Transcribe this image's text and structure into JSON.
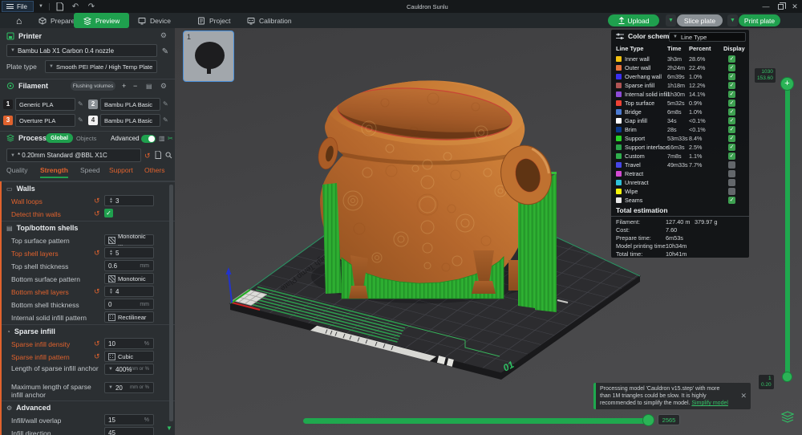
{
  "titlebar": {
    "file": "File",
    "title": "Cauldron Sunlu"
  },
  "toolbar": {
    "tabs": [
      {
        "label": "Prepare",
        "icon": "prepare-icon",
        "active": false
      },
      {
        "label": "Preview",
        "icon": "preview-icon",
        "active": true
      },
      {
        "label": "Device",
        "icon": "device-icon",
        "active": false
      },
      {
        "label": "Project",
        "icon": "project-icon",
        "active": false
      },
      {
        "label": "Calibration",
        "icon": "calibration-icon",
        "active": false
      }
    ],
    "upload": "Upload",
    "slice": "Slice plate",
    "print": "Print plate"
  },
  "printer": {
    "title": "Printer",
    "name": "Bambu Lab X1 Carbon 0.4 nozzle",
    "plate_type_label": "Plate type",
    "plate_type": "Smooth PEI Plate / High Temp Plate"
  },
  "filament": {
    "title": "Filament",
    "flushing": "Flushing volumes",
    "slots": [
      {
        "num": "1",
        "color": "#1d1d1f",
        "text": "#ffffff",
        "name": "Generic PLA"
      },
      {
        "num": "2",
        "color": "#8b9196",
        "text": "#ffffff",
        "name": "Bambu PLA Basic"
      },
      {
        "num": "3",
        "color": "#e0622d",
        "text": "#ffffff",
        "name": "Overture PLA"
      },
      {
        "num": "4",
        "color": "#f2f2f2",
        "text": "#333333",
        "name": "Bambu PLA Basic"
      }
    ]
  },
  "process": {
    "title": "Process",
    "global": "Global",
    "objects": "Objects",
    "advanced": "Advanced",
    "preset": "* 0.20mm Standard @BBL X1C",
    "tabs": [
      {
        "label": "Quality",
        "state": "normal"
      },
      {
        "label": "Strength",
        "state": "selected"
      },
      {
        "label": "Speed",
        "state": "normal"
      },
      {
        "label": "Support",
        "state": "modified"
      },
      {
        "label": "Others",
        "state": "modified"
      }
    ]
  },
  "settings": {
    "sections": [
      {
        "title": "Walls",
        "rows": [
          {
            "label": "Wall loops",
            "mod": true,
            "reset": true,
            "type": "spin",
            "value": "3"
          },
          {
            "label": "Detect thin walls",
            "mod": true,
            "reset": true,
            "type": "check",
            "checked": true
          }
        ]
      },
      {
        "title": "Top/bottom shells",
        "rows": [
          {
            "label": "Top surface pattern",
            "type": "pattern",
            "value": "Monotonic ..."
          },
          {
            "label": "Top shell layers",
            "mod": true,
            "reset": true,
            "type": "spin",
            "value": "5"
          },
          {
            "label": "Top shell thickness",
            "type": "unit",
            "value": "0.6",
            "unit": "mm"
          },
          {
            "label": "Bottom surface pattern",
            "type": "pattern",
            "value": "Monotonic"
          },
          {
            "label": "Bottom shell layers",
            "mod": true,
            "reset": true,
            "type": "spin",
            "value": "4"
          },
          {
            "label": "Bottom shell thickness",
            "type": "unit",
            "value": "0",
            "unit": "mm"
          },
          {
            "label": "Internal solid infill pattern",
            "type": "pattern",
            "value": "Rectilinear",
            "pat": "dots"
          }
        ]
      },
      {
        "title": "Sparse infill",
        "rows": [
          {
            "label": "Sparse infill density",
            "mod": true,
            "reset": true,
            "type": "unit",
            "value": "10",
            "unit": "%"
          },
          {
            "label": "Sparse infill pattern",
            "mod": true,
            "reset": true,
            "type": "pattern",
            "value": "Cubic",
            "pat": "dots"
          },
          {
            "label": "Length of sparse infill anchor",
            "twoline": true,
            "type": "combo",
            "value": "400%",
            "unit": "mm or %"
          },
          {
            "label": "Maximum length of sparse infill anchor",
            "twoline": true,
            "type": "combo",
            "value": "20",
            "unit": "mm or %"
          }
        ]
      },
      {
        "title": "Advanced",
        "rows": [
          {
            "label": "Infill/wall overlap",
            "type": "unit",
            "value": "15",
            "unit": "%"
          },
          {
            "label": "Infill direction",
            "type": "unit",
            "value": "45",
            "unit": ""
          }
        ]
      }
    ]
  },
  "color_scheme": {
    "title": "Color scheme",
    "dropdown": "Line Type",
    "columns": [
      "Line Type",
      "Time",
      "Percent",
      "Display"
    ],
    "rows": [
      {
        "name": "Inner wall",
        "color": "#f5c211",
        "time": "3h3m",
        "pct": "28.6%",
        "on": true
      },
      {
        "name": "Outer wall",
        "color": "#e8733d",
        "time": "2h24m",
        "pct": "22.4%",
        "on": true
      },
      {
        "name": "Overhang wall",
        "color": "#3a2ff0",
        "time": "6m39s",
        "pct": "1.0%",
        "on": true
      },
      {
        "name": "Sparse infill",
        "color": "#b05454",
        "time": "1h18m",
        "pct": "12.2%",
        "on": true
      },
      {
        "name": "Internal solid infill",
        "color": "#8d4bd6",
        "time": "1h30m",
        "pct": "14.1%",
        "on": true
      },
      {
        "name": "Top surface",
        "color": "#ee4235",
        "time": "5m32s",
        "pct": "0.9%",
        "on": true
      },
      {
        "name": "Bridge",
        "color": "#4b7ad1",
        "time": "6m8s",
        "pct": "1.0%",
        "on": true
      },
      {
        "name": "Gap infill",
        "color": "#ffffff",
        "time": "34s",
        "pct": "<0.1%",
        "on": true
      },
      {
        "name": "Brim",
        "color": "#0c3a8c",
        "time": "28s",
        "pct": "<0.1%",
        "on": true
      },
      {
        "name": "Support",
        "color": "#27d427",
        "time": "53m33s",
        "pct": "8.4%",
        "on": true
      },
      {
        "name": "Support interface",
        "color": "#2aa34a",
        "time": "16m3s",
        "pct": "2.5%",
        "on": true
      },
      {
        "name": "Custom",
        "color": "#2fae4d",
        "time": "7m8s",
        "pct": "1.1%",
        "on": true
      },
      {
        "name": "Travel",
        "color": "#4646e8",
        "time": "49m33s",
        "pct": "7.7%",
        "on": false
      },
      {
        "name": "Retract",
        "color": "#d24ad2",
        "time": "",
        "pct": "",
        "on": false
      },
      {
        "name": "Unretract",
        "color": "#2ec0d8",
        "time": "",
        "pct": "",
        "on": false
      },
      {
        "name": "Wipe",
        "color": "#f5f50a",
        "time": "",
        "pct": "",
        "on": false
      },
      {
        "name": "Seams",
        "color": "#e9e9e9",
        "time": "",
        "pct": "",
        "on": true
      }
    ],
    "total_title": "Total estimation",
    "totals": [
      {
        "k": "Filament:",
        "v1": "127.40 m",
        "v2": "379.97 g"
      },
      {
        "k": "Cost:",
        "v1": "7.60",
        "v2": ""
      },
      {
        "k": "Prepare time:",
        "v1": "6m53s",
        "v2": ""
      },
      {
        "k": "Model printing time:",
        "v1": "10h34m",
        "v2": ""
      },
      {
        "k": "Total time:",
        "v1": "10h41m",
        "v2": ""
      }
    ]
  },
  "viewport": {
    "plate_number": "1",
    "plate_corner_label": "01",
    "plate_text": "High Temp Plate",
    "vslider_top": [
      "1030",
      "153.60"
    ],
    "vslider_bottom": [
      "1",
      "0.20"
    ],
    "hslider_badge": "2565"
  },
  "notification": {
    "text_before": "Processing model 'Cauldron v15.step' with more than 1M triangles could be slow. It is highly recommended to simplify the model. ",
    "link": "Simplify model"
  }
}
